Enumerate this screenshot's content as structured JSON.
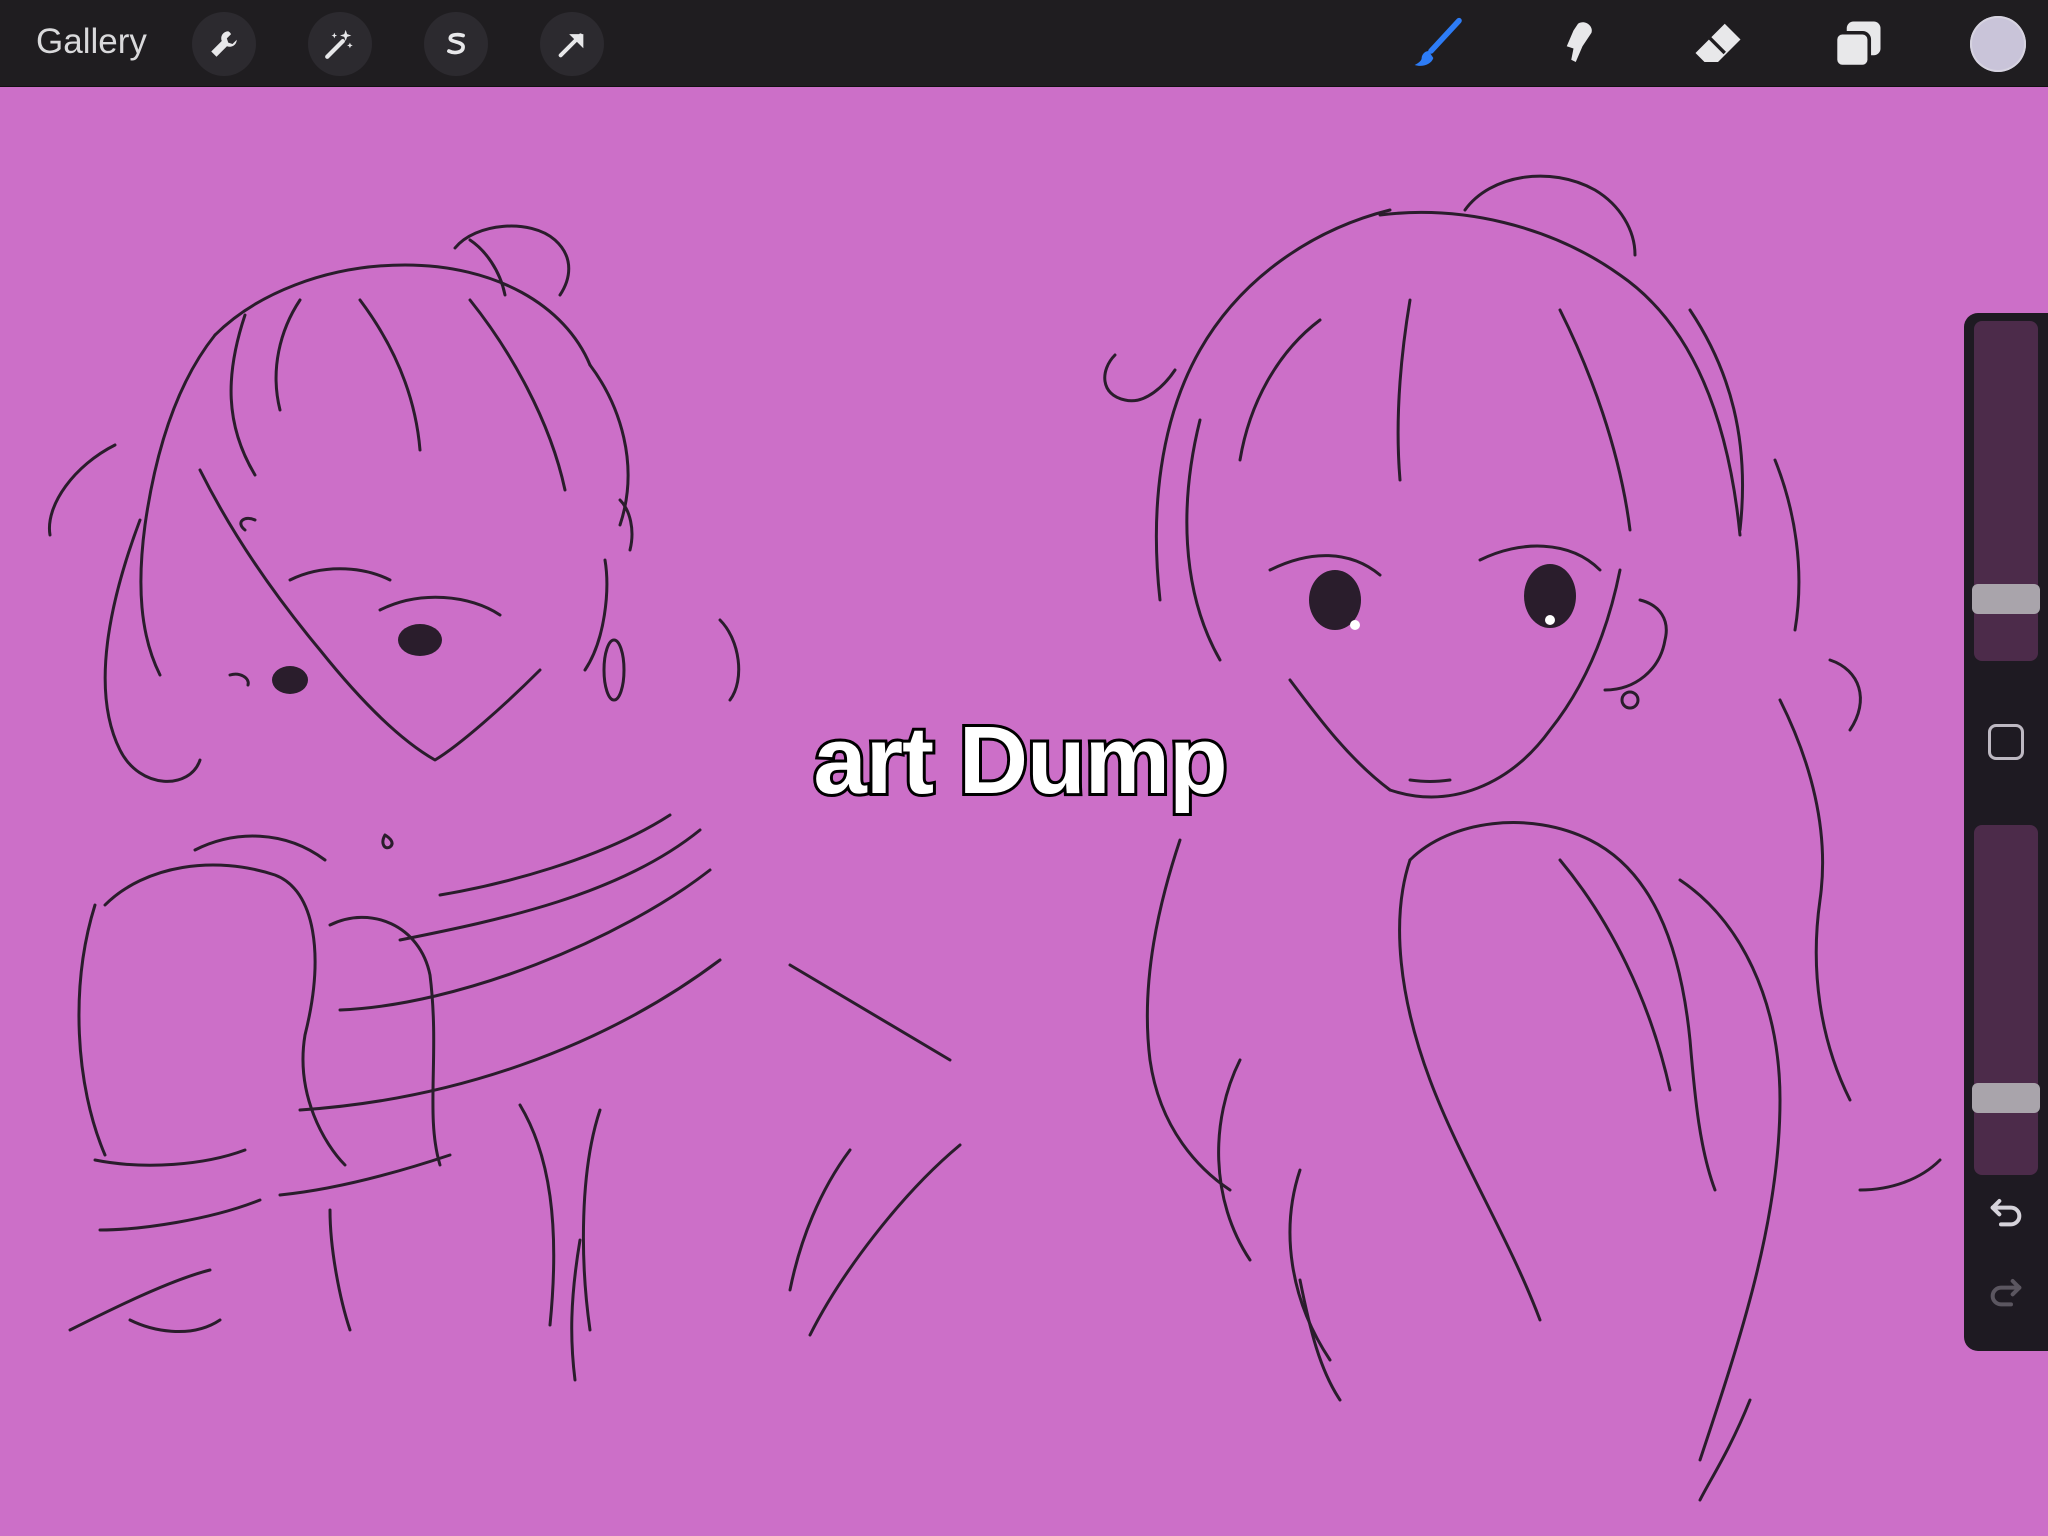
{
  "toolbar": {
    "gallery_label": "Gallery",
    "left_tools": [
      "wrench-icon",
      "magic-wand-icon",
      "selection-s-icon",
      "move-arrow-icon"
    ],
    "right_tools": [
      "brush-icon",
      "smudge-icon",
      "eraser-icon",
      "layers-icon"
    ],
    "active_tool": "brush",
    "active_color": "#c9c4d9",
    "accent_color": "#2d7cf6"
  },
  "canvas": {
    "background_color": "#cc6fc8",
    "overlay_text": "art Dump"
  },
  "sidebar": {
    "brush_size_level": 0.73,
    "opacity_level": 0.13,
    "modify_button": "square-button",
    "undo": "undo-icon",
    "redo": "redo-icon"
  }
}
